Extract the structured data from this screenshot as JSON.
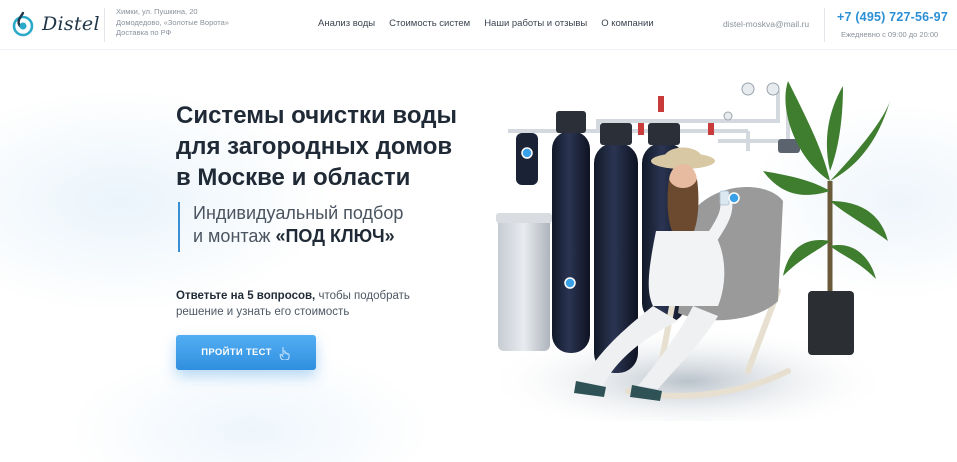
{
  "header": {
    "logo_text": "Distel",
    "address_lines": [
      "Химки, ул. Пушкина, 20",
      "Домодедово, «Золотые Ворота»",
      "Доставка по РФ"
    ],
    "nav": [
      "Анализ воды",
      "Стоимость систем",
      "Наши работы и отзывы",
      "О компании"
    ],
    "email": "distel-moskva@mail.ru",
    "phone": "+7 (495) 727-56-97",
    "hours": "Ежедневно с 09:00 до 20:00"
  },
  "hero": {
    "title_lines": [
      "Системы очистки воды",
      "для загородных домов",
      "в Москве и области"
    ],
    "subtitle_line1": "Индивидуальный подбор",
    "subtitle_line2_prefix": "и монтаж ",
    "subtitle_line2_accent": "«ПОД КЛЮЧ»",
    "lead_strong": "Ответьте на 5 вопросов,",
    "lead_rest_1": " чтобы подобрать",
    "lead_line2": "решение и узнать его стоимость",
    "cta_label": "ПРОЙТИ ТЕСТ",
    "cta_icon": "pointer-hand-icon"
  },
  "colors": {
    "accent": "#2f8fe0",
    "phone": "#2b8fd6",
    "title": "#1f2a36",
    "tank": "#1b2238"
  }
}
